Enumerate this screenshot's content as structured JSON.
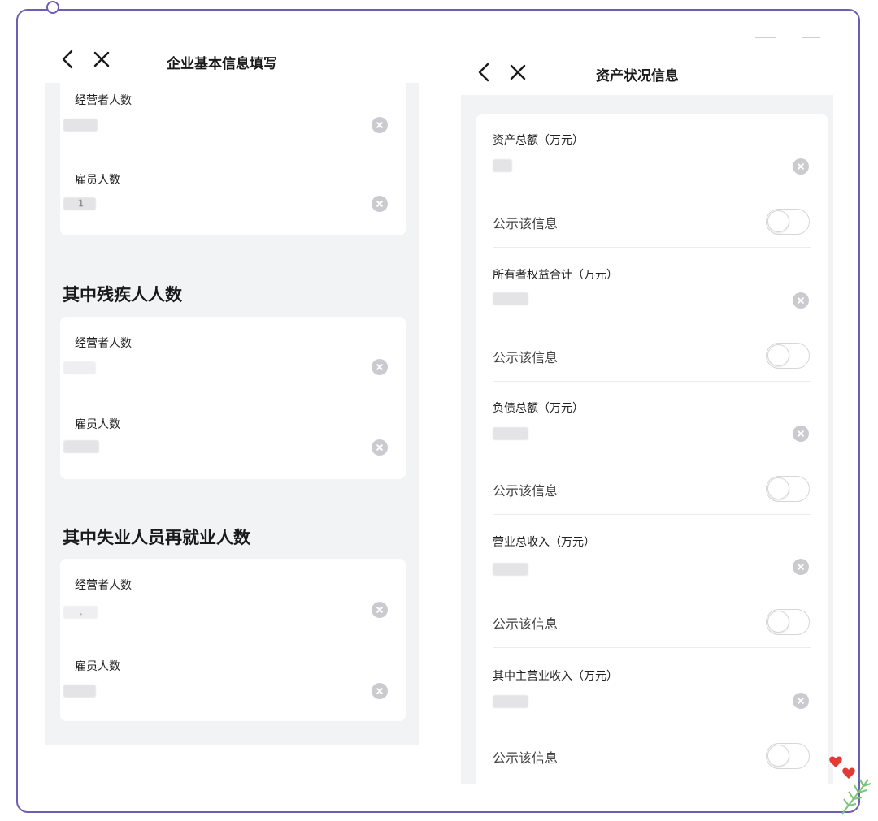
{
  "left_screen": {
    "title": "企业基本信息填写",
    "card1": {
      "fields": [
        {
          "label": "经营者人数",
          "value": ""
        },
        {
          "label": "雇员人数",
          "value": "1"
        }
      ]
    },
    "section2": {
      "title": "其中残疾人人数",
      "fields": [
        {
          "label": "经营者人数",
          "value": ""
        },
        {
          "label": "雇员人数",
          "value": ""
        }
      ]
    },
    "section3": {
      "title": "其中失业人员再就业人数",
      "fields": [
        {
          "label": "经营者人数",
          "value": "."
        },
        {
          "label": "雇员人数",
          "value": ""
        }
      ]
    }
  },
  "right_screen": {
    "title": "资产状况信息",
    "fields": [
      {
        "label": "资产总额（万元）",
        "value": "",
        "toggle_label": "公示该信息",
        "toggle_on": false
      },
      {
        "label": "所有者权益合计（万元）",
        "value": "",
        "toggle_label": "公示该信息",
        "toggle_on": false
      },
      {
        "label": "负债总额（万元）",
        "value": "",
        "toggle_label": "公示该信息",
        "toggle_on": false
      },
      {
        "label": "营业总收入（万元）",
        "value": "",
        "toggle_label": "公示该信息",
        "toggle_on": false
      },
      {
        "label": "其中主营业收入（万元）",
        "value": "",
        "toggle_label": "公示该信息",
        "toggle_on": false
      }
    ]
  },
  "icons": {
    "back": "chevron-left-icon",
    "close": "close-icon",
    "clear": "clear-circle-icon"
  },
  "colors": {
    "frame_border": "#6b5fb5",
    "page_background": "#f2f3f5",
    "card_background": "#ffffff",
    "decoration_heart": "#e53935",
    "decoration_leaf": "#7cc47a"
  }
}
